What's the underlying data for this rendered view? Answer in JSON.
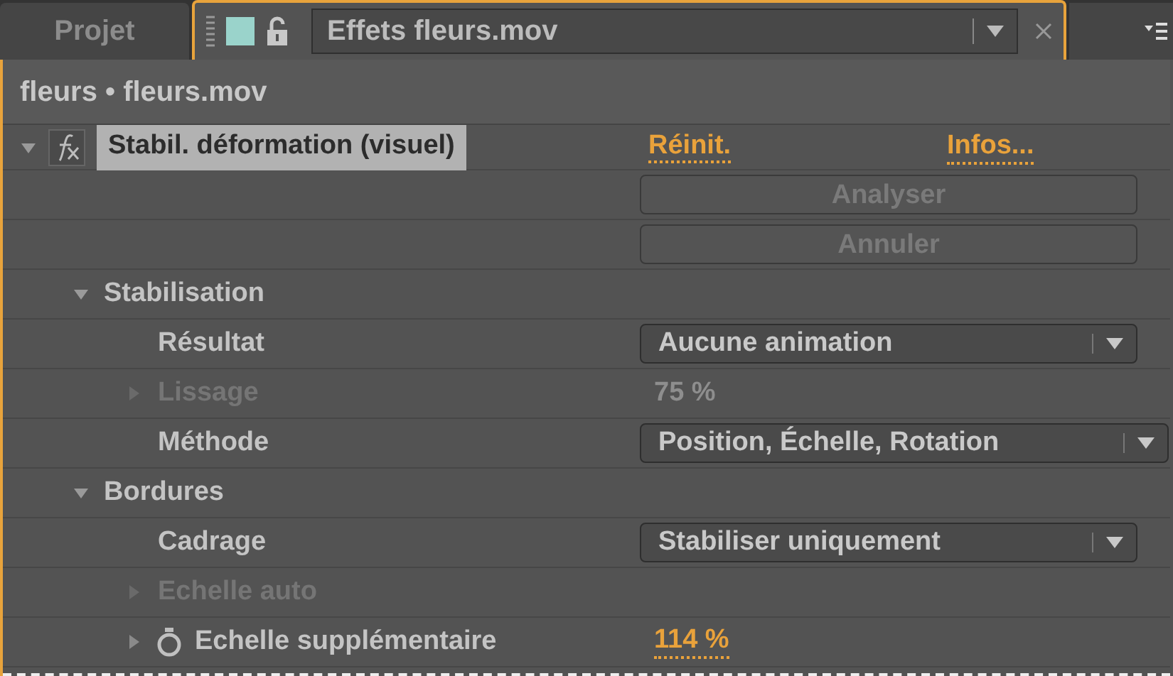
{
  "tabs": [
    {
      "label": "Projet",
      "selected": false
    },
    {
      "label": "Effets fleurs.mov",
      "selected": true
    }
  ],
  "breadcrumb": "fleurs • fleurs.mov",
  "effect": {
    "name": "Stabil. déformation (visuel)",
    "expanded": true,
    "reset": "Réinit.",
    "about": "Infos...",
    "actions": [
      {
        "label": "Analyser",
        "disabled": true
      },
      {
        "label": "Annuler",
        "disabled": true
      }
    ],
    "params": [
      {
        "kind": "group",
        "label": "Stabilisation",
        "expanded": true,
        "children": [
          {
            "kind": "dropdown",
            "label": "Résultat",
            "value": "Aucune animation"
          },
          {
            "kind": "value",
            "label": "Lissage",
            "value": "75 %",
            "disabled": true,
            "expanded": false
          },
          {
            "kind": "dropdown",
            "label": "Méthode",
            "value": "Position, Échelle, Rotation"
          }
        ]
      },
      {
        "kind": "group",
        "label": "Bordures",
        "expanded": true,
        "children": [
          {
            "kind": "dropdown",
            "label": "Cadrage",
            "value": "Stabiliser uniquement"
          },
          {
            "kind": "value",
            "label": "Echelle auto",
            "disabled": true,
            "expanded": false
          },
          {
            "kind": "value",
            "label": "Echelle supplémentaire",
            "value": "114 %",
            "disabled": false,
            "expanded": false,
            "stopwatch": true
          }
        ]
      }
    ]
  }
}
